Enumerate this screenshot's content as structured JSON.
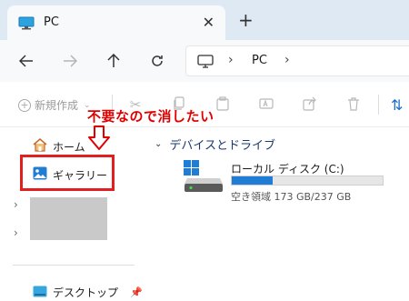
{
  "tab": {
    "title": "PC",
    "close": "✕",
    "new_tab": "+"
  },
  "address": {
    "crumb": "PC",
    "sep": "›"
  },
  "toolbar": {
    "new_label": "新規作成"
  },
  "annotation": {
    "text": "不要なので消したい"
  },
  "nav": {
    "home": "ホーム",
    "gallery": "ギャラリー",
    "desktop": "デスクトップ"
  },
  "content": {
    "group_title": "デバイスとドライブ",
    "drive": {
      "name": "ローカル ディスク (C:)",
      "space": "空き領域 173 GB/237 GB",
      "used_fraction": 0.27
    }
  },
  "colors": {
    "annotation": "#e00000",
    "accent": "#1f7dd6"
  }
}
